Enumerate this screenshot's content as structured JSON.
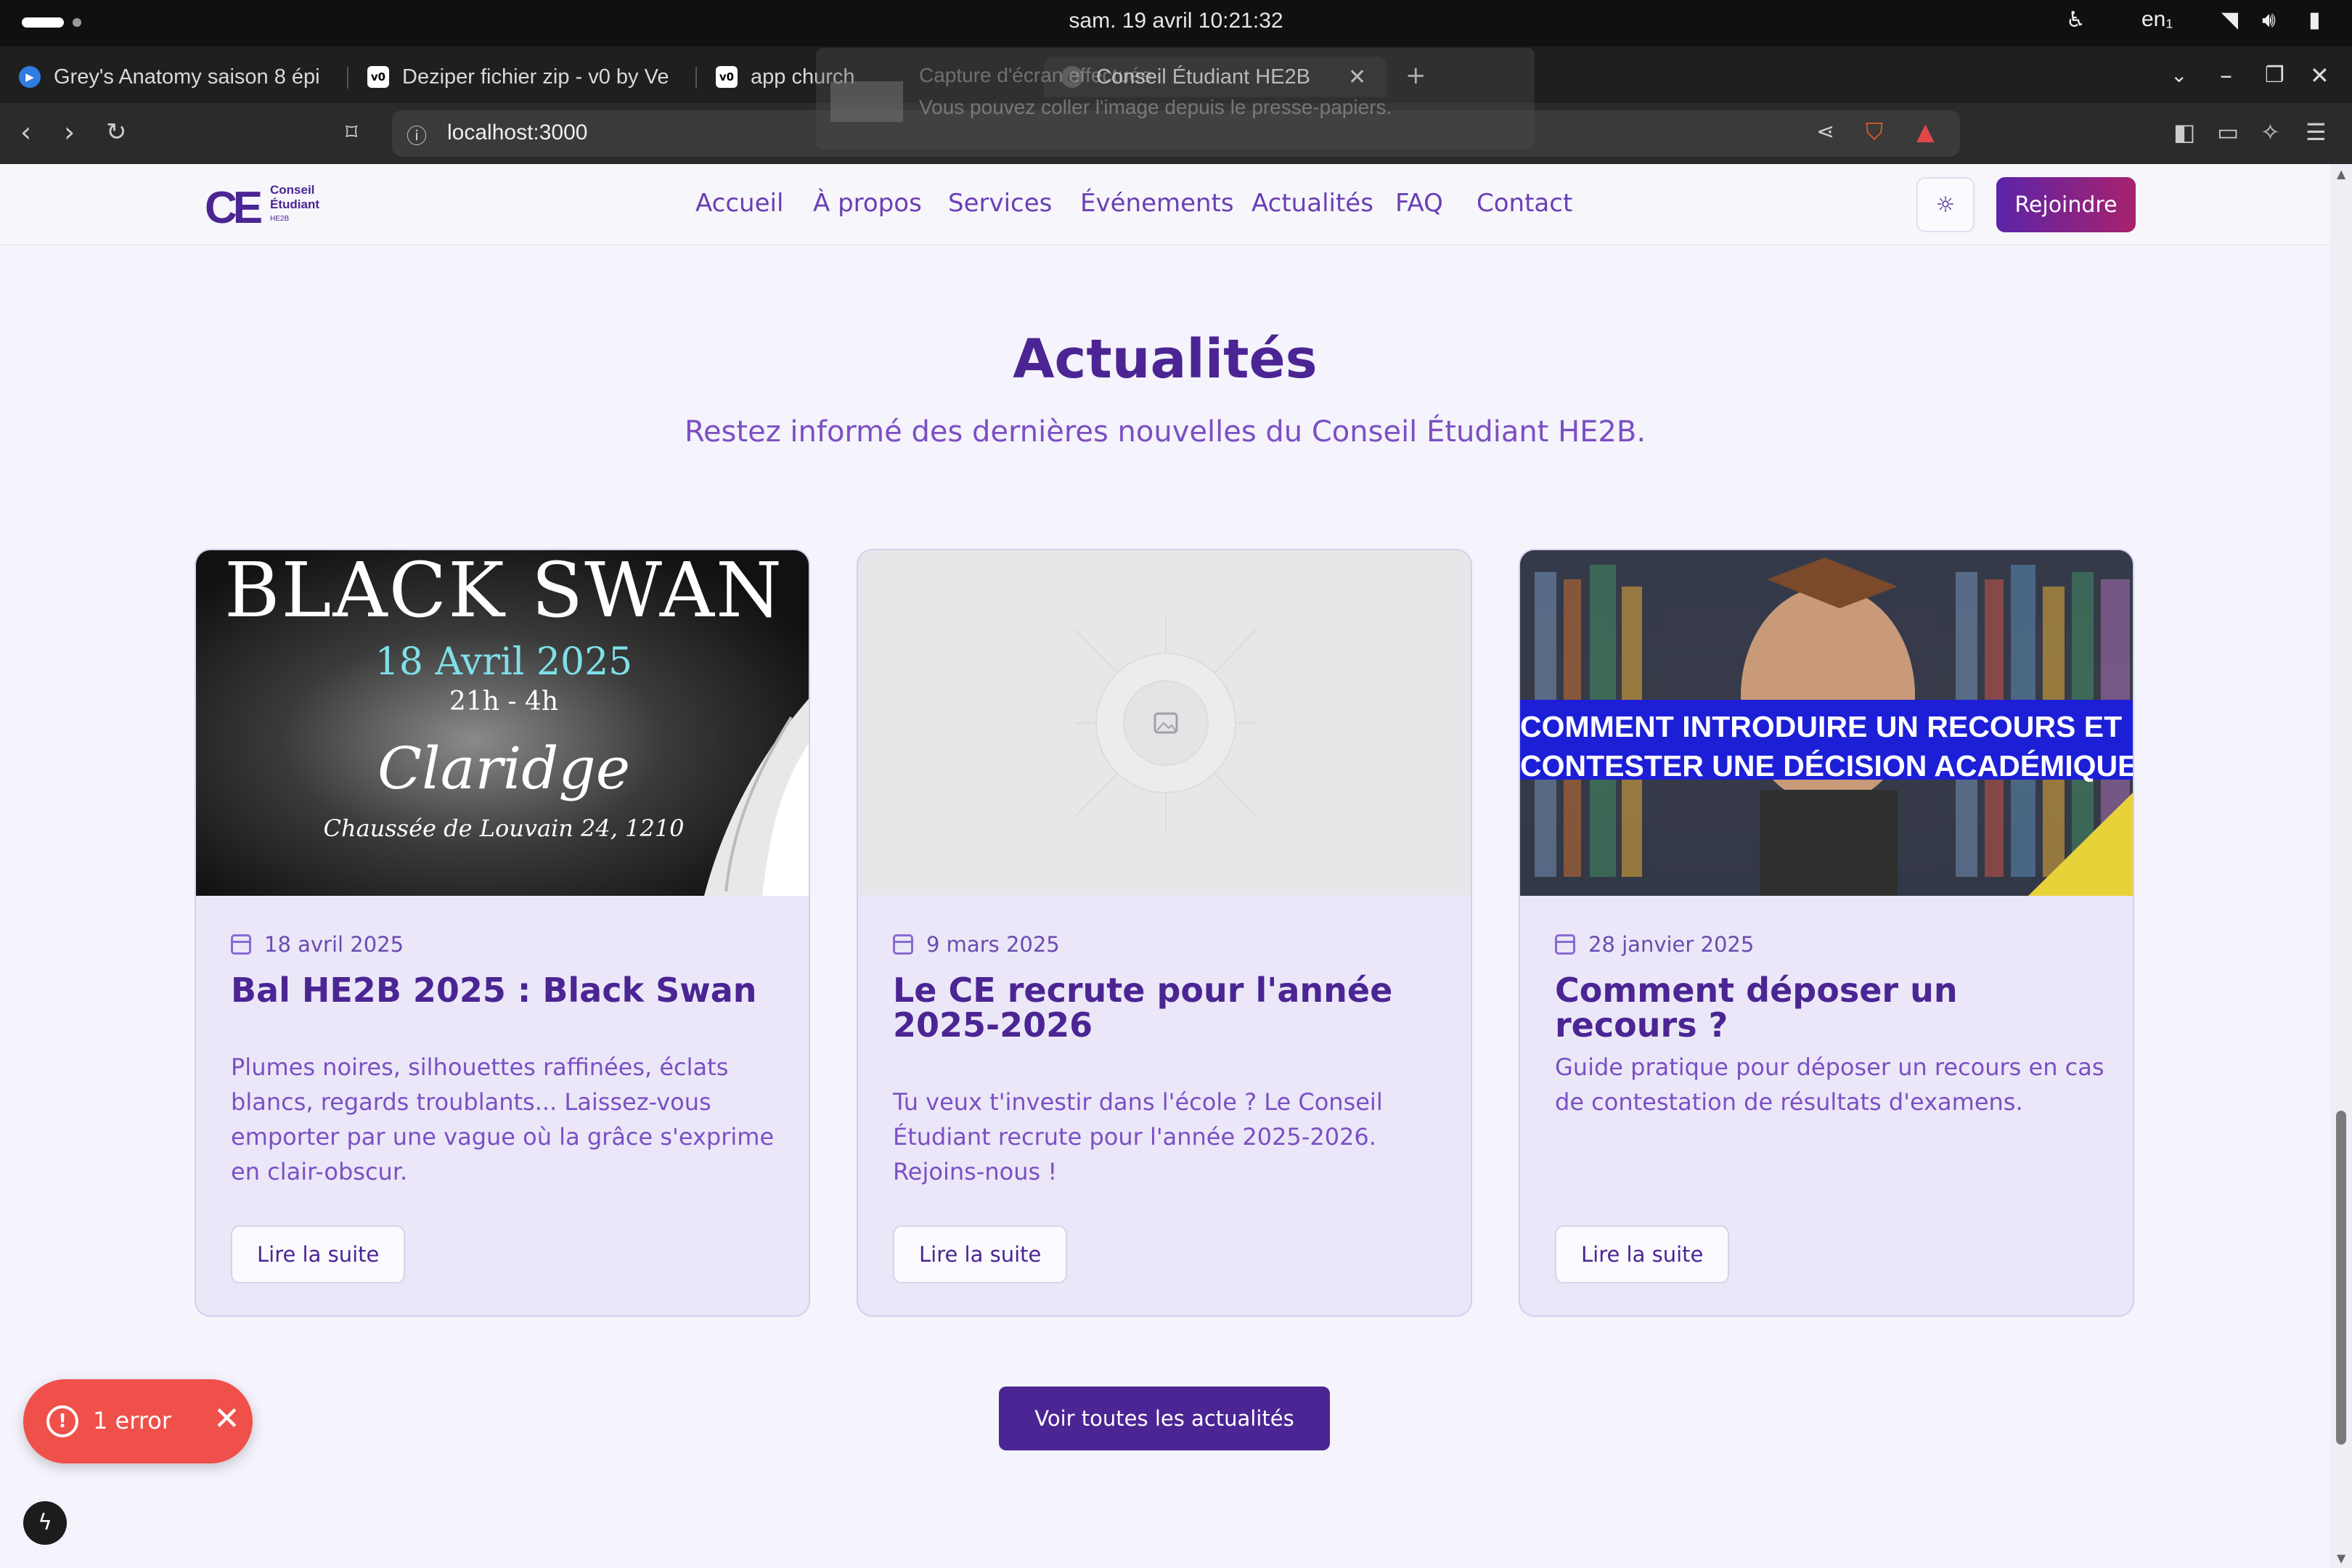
{
  "os": {
    "clock": "sam. 19 avril  10:21:32",
    "lang": "en₁"
  },
  "tabs": [
    {
      "label": "Grey's Anatomy saison 8 épi",
      "icon": "play-icon"
    },
    {
      "label": "Deziper fichier zip - v0 by Ve",
      "icon": "v0-icon"
    },
    {
      "label": "app church",
      "icon": "v0-icon"
    },
    {
      "label": "Conseil Étudiant HE2B",
      "icon": "globe-icon",
      "active": true
    }
  ],
  "address": {
    "url": "localhost:3000"
  },
  "ghost_toast": {
    "title": "Capture d'écran effectuée",
    "body": "Vous pouvez coller l'image depuis le presse-papiers."
  },
  "site": {
    "logo": {
      "mark": "CE",
      "line1": "Conseil",
      "line2": "Étudiant",
      "line3": "HE2B"
    },
    "nav": [
      "Accueil",
      "À propos",
      "Services",
      "Événements",
      "Actualités",
      "FAQ",
      "Contact"
    ],
    "join_label": "Rejoindre",
    "colors": {
      "primary": "#4b2593",
      "accent": "#a8226d",
      "text": "#7b4fc4"
    }
  },
  "section": {
    "title": "Actualités",
    "subtitle": "Restez informé des dernières nouvelles du Conseil Étudiant HE2B.",
    "read_more": "Lire la suite",
    "all_button": "Voir toutes les actualités"
  },
  "cards": [
    {
      "date": "18 avril 2025",
      "title": "Bal HE2B 2025 : Black Swan",
      "excerpt": "Plumes noires, silhouettes raffinées, éclats blancs, regards troublants... Laissez-vous emporter par une vague où la grâce s'exprime en clair-obscur.",
      "poster": {
        "line1": "BLACK SWAN",
        "line2": "18 Avril 2025",
        "line3": "21h - 4h",
        "line4": "Claridge",
        "line5": "Chaussée de Louvain 24, 1210"
      }
    },
    {
      "date": "9 mars 2025",
      "title": "Le CE recrute pour l'année 2025-2026",
      "excerpt": "Tu veux t'investir dans l'école ? Le Conseil Étudiant recrute pour l'année 2025-2026. Rejoins-nous !"
    },
    {
      "date": "28 janvier 2025",
      "title": "Comment déposer un recours ?",
      "excerpt": "Guide pratique pour déposer un recours en cas de contestation de résultats d'examens.",
      "banner": {
        "line1": "COMMENT INTRODUIRE UN RECOURS ET",
        "line2": "CONTESTER UNE DÉCISION ACADÉMIQUE"
      }
    }
  ],
  "error_toast": {
    "label": "1 error"
  }
}
